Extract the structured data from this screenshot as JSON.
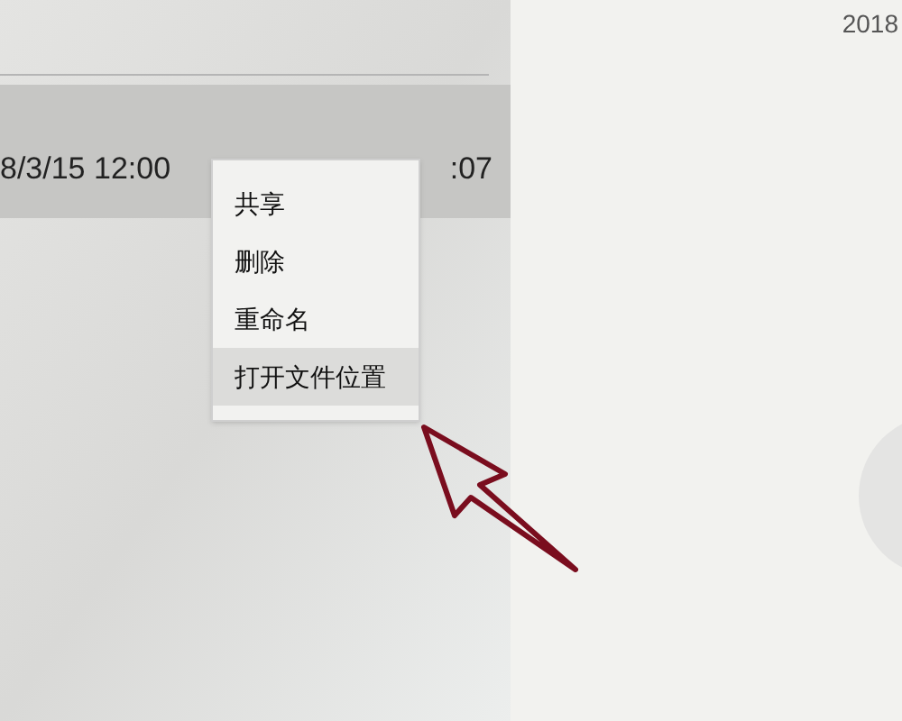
{
  "recordings_panel": {
    "recording": {
      "date": "8/3/15 12:00",
      "duration": ":07",
      "selected": true
    }
  },
  "context_menu": {
    "items": [
      {
        "label": "共享",
        "selected": false
      },
      {
        "label": "删除",
        "selected": false
      },
      {
        "label": "重命名",
        "selected": false
      },
      {
        "label": "打开文件位置",
        "selected": true
      }
    ]
  },
  "detail_panel": {
    "date": "2018"
  }
}
